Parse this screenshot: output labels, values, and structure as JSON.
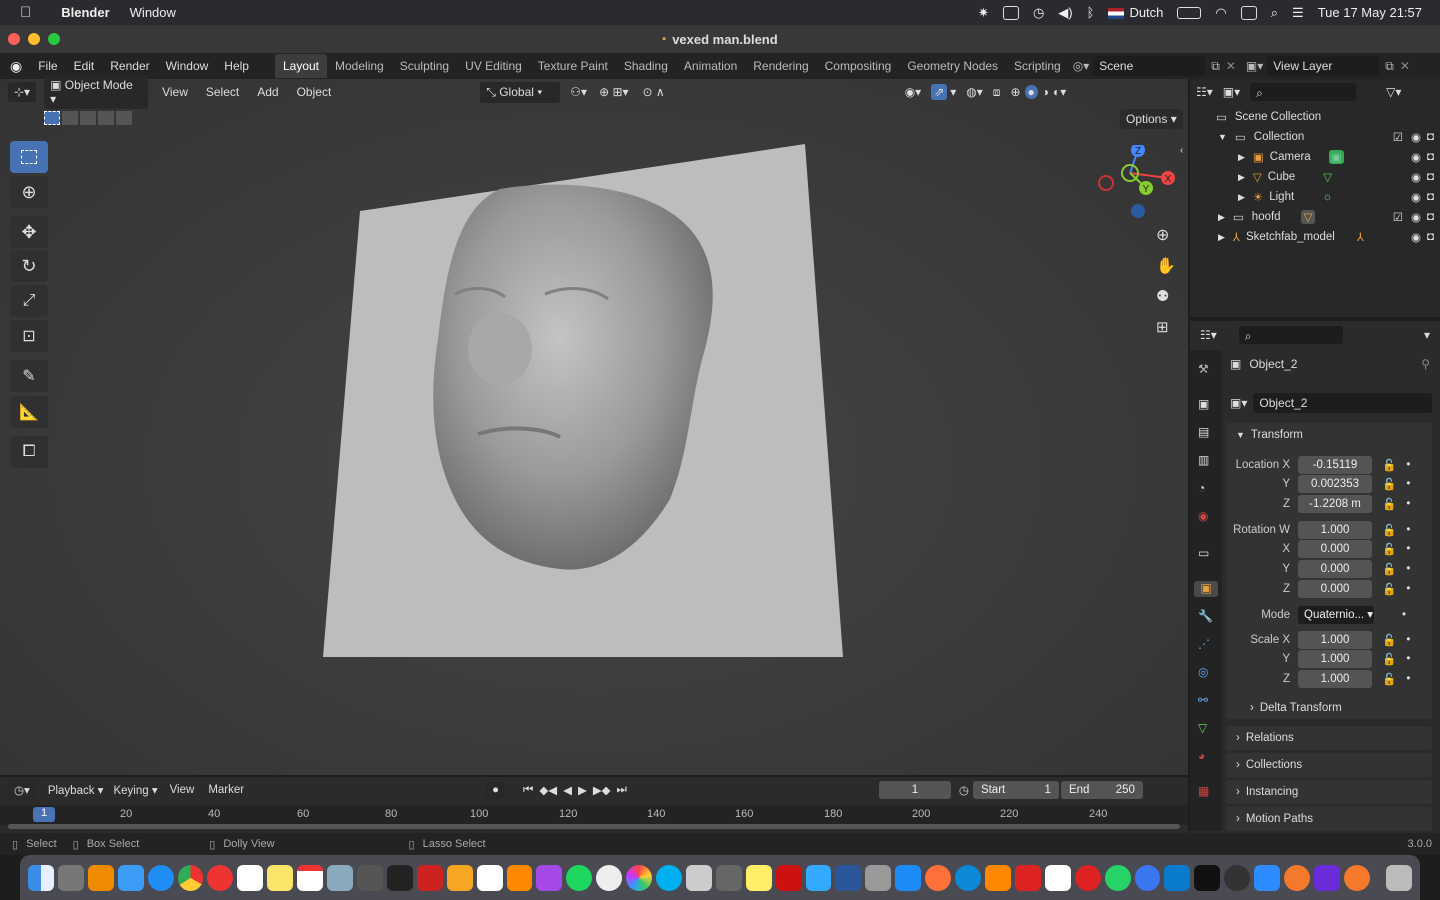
{
  "macbar": {
    "app": "Blender",
    "menu": "Window",
    "input_source": "Dutch",
    "datetime": "Tue 17 May  21:57"
  },
  "window": {
    "title": "vexed man.blend"
  },
  "topbar": {
    "menus": [
      "File",
      "Edit",
      "Render",
      "Window",
      "Help"
    ],
    "workspaces": [
      "Layout",
      "Modeling",
      "Sculpting",
      "UV Editing",
      "Texture Paint",
      "Shading",
      "Animation",
      "Rendering",
      "Compositing",
      "Geometry Nodes",
      "Scripting"
    ],
    "scene": "Scene",
    "view_layer": "View Layer"
  },
  "viewport": {
    "mode": "Object Mode",
    "menus": [
      "View",
      "Select",
      "Add",
      "Object"
    ],
    "orientation": "Global",
    "options": "Options",
    "gizmo": {
      "x": "X",
      "y": "Y",
      "z": "Z"
    }
  },
  "outliner": {
    "root": "Scene Collection",
    "items": [
      {
        "name": "Collection",
        "depth": 1
      },
      {
        "name": "Camera",
        "depth": 2
      },
      {
        "name": "Cube",
        "depth": 2
      },
      {
        "name": "Light",
        "depth": 2
      },
      {
        "name": "hoofd",
        "depth": 1
      },
      {
        "name": "Sketchfab_model",
        "depth": 1
      }
    ]
  },
  "properties": {
    "object_name": "Object_2",
    "object_field": "Object_2",
    "transform_label": "Transform",
    "location": {
      "label": "Location X",
      "x": "-0.15119",
      "y": "0.002353",
      "z": "-1.2208 m"
    },
    "rotation": {
      "label": "Rotation W",
      "w": "1.000",
      "x": "0.000",
      "y": "0.000",
      "z": "0.000"
    },
    "mode_label": "Mode",
    "mode": "Quaternio...",
    "scale": {
      "label": "Scale X",
      "x": "1.000",
      "y": "1.000",
      "z": "1.000"
    },
    "axis_labels": {
      "y": "Y",
      "z": "Z",
      "x": "X"
    },
    "delta": "Delta Transform",
    "panels": [
      "Relations",
      "Collections",
      "Instancing",
      "Motion Paths"
    ]
  },
  "timeline": {
    "menus": [
      "Playback",
      "Keying",
      "View",
      "Marker"
    ],
    "current_frame": "1",
    "start_label": "Start",
    "start": "1",
    "end_label": "End",
    "end": "250",
    "ruler": [
      "1",
      "20",
      "40",
      "60",
      "80",
      "100",
      "120",
      "140",
      "160",
      "180",
      "200",
      "220",
      "240"
    ]
  },
  "status": {
    "select": "Select",
    "box_select": "Box Select",
    "dolly": "Dolly View",
    "lasso": "Lasso Select",
    "version": "3.0.0"
  }
}
